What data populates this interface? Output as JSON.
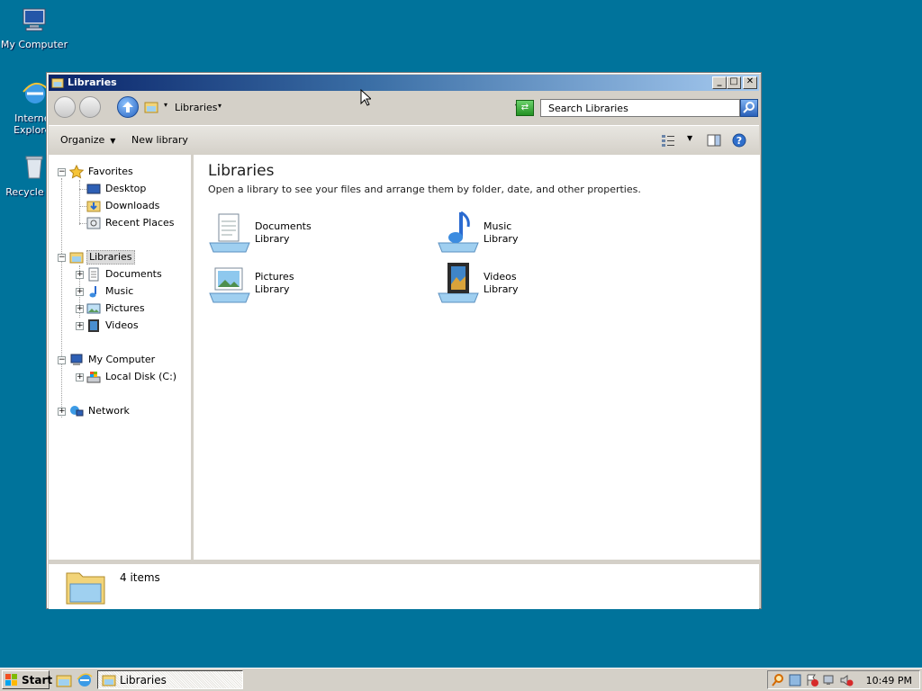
{
  "desktop": {
    "icons": [
      {
        "label": "My Computer",
        "icon": "my-computer-icon"
      },
      {
        "label": "Internet Explorer",
        "icon": "internet-explorer-icon"
      },
      {
        "label": "Recycle Bin",
        "icon": "recycle-bin-icon"
      }
    ]
  },
  "window": {
    "title": "Libraries",
    "address": {
      "path": "Libraries"
    },
    "search": {
      "placeholder": "Search Libraries"
    },
    "command_bar": {
      "organize": "Organize",
      "new_library": "New library"
    },
    "nav_tree": {
      "favorites": {
        "label": "Favorites",
        "children": [
          "Desktop",
          "Downloads",
          "Recent Places"
        ]
      },
      "libraries": {
        "label": "Libraries",
        "children": [
          "Documents",
          "Music",
          "Pictures",
          "Videos"
        ]
      },
      "computer": {
        "label": "My Computer",
        "children": [
          "Local Disk (C:)"
        ]
      },
      "network": {
        "label": "Network"
      }
    },
    "content": {
      "heading": "Libraries",
      "description": "Open a library to see your files and arrange them by folder, date, and other properties.",
      "libraries": [
        {
          "name": "Documents",
          "kind": "Library",
          "icon": "documents-library-icon"
        },
        {
          "name": "Music",
          "kind": "Library",
          "icon": "music-library-icon"
        },
        {
          "name": "Pictures",
          "kind": "Library",
          "icon": "pictures-library-icon"
        },
        {
          "name": "Videos",
          "kind": "Library",
          "icon": "videos-library-icon"
        }
      ]
    },
    "details": {
      "item_count": "4 items"
    }
  },
  "taskbar": {
    "start_label": "Start",
    "task_label": "Libraries",
    "clock": "10:49 PM"
  },
  "colors": {
    "desktop": "#00739b",
    "titlebar_start": "#0a246a",
    "titlebar_end": "#a6caf0"
  }
}
